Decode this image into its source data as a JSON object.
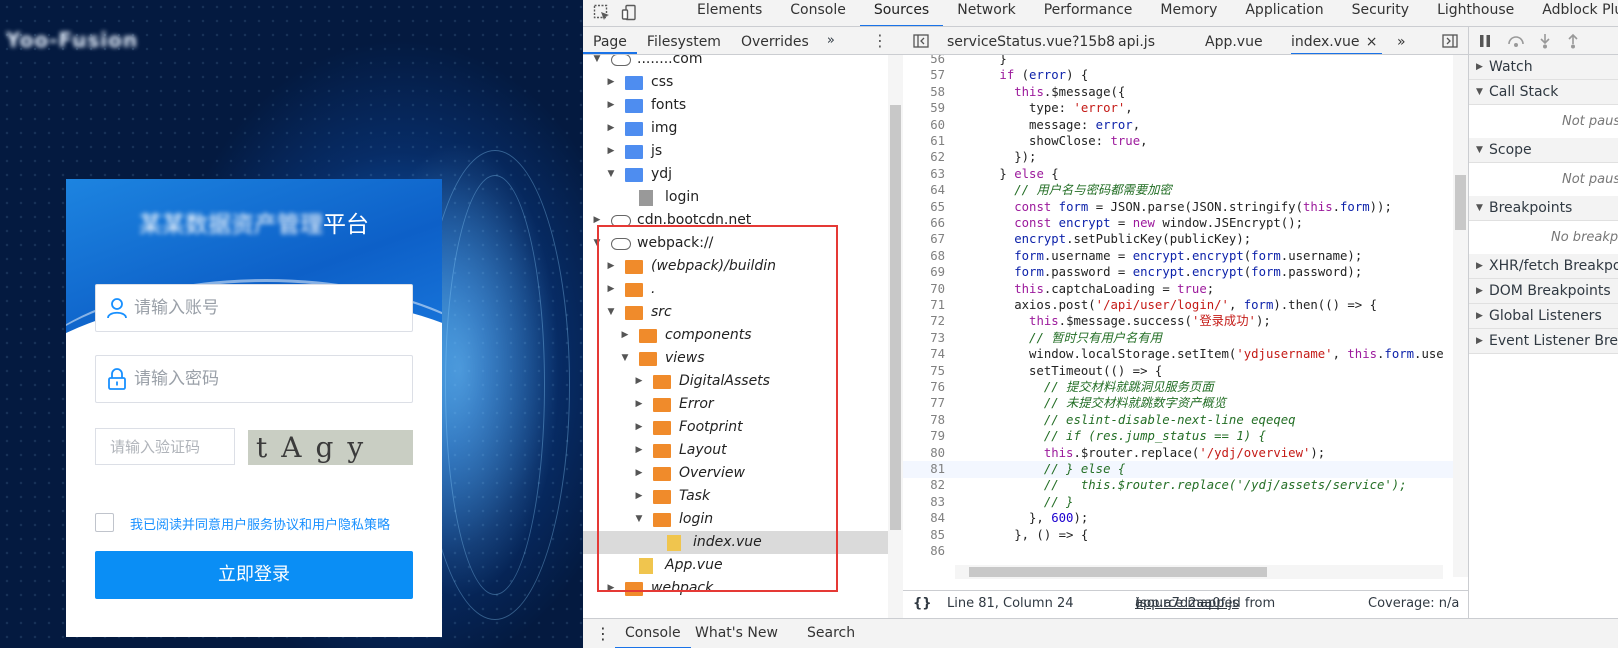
{
  "login": {
    "logo_text": "Yoo-Fusion",
    "title_blurred": "某某数据资产管理",
    "title_suffix": "平台",
    "username_placeholder": "请输入账号",
    "password_placeholder": "请输入密码",
    "captcha_placeholder": "请输入验证码",
    "captcha_text": "tAgy",
    "agreement": "我已阅读并同意用户服务协议和用户隐私策略",
    "submit_label": "立即登录"
  },
  "devtools": {
    "main_tabs": [
      "Elements",
      "Console",
      "Sources",
      "Network",
      "Performance",
      "Memory",
      "Application",
      "Security",
      "Lighthouse",
      "Adblock Plus"
    ],
    "main_more": "»",
    "nav_tabs": [
      "Page",
      "Filesystem",
      "Overrides"
    ],
    "nav_more": "»",
    "tree": [
      {
        "label": "........com",
        "type": "cloud",
        "depth": 0,
        "open": true
      },
      {
        "label": "css",
        "type": "folder-blue",
        "depth": 1
      },
      {
        "label": "fonts",
        "type": "folder-blue",
        "depth": 1
      },
      {
        "label": "img",
        "type": "folder-blue",
        "depth": 1
      },
      {
        "label": "js",
        "type": "folder-blue",
        "depth": 1
      },
      {
        "label": "ydj",
        "type": "folder-blue",
        "depth": 1,
        "open": true
      },
      {
        "label": "login",
        "type": "file-g",
        "depth": 2
      },
      {
        "label": "cdn.bootcdn.net",
        "type": "cloud",
        "depth": 0
      },
      {
        "label": "webpack://",
        "type": "cloud",
        "depth": 0,
        "open": true
      },
      {
        "label": "(webpack)/buildin",
        "type": "folder-orange",
        "depth": 1,
        "italic": true
      },
      {
        "label": ".",
        "type": "folder-orange",
        "depth": 1,
        "italic": true
      },
      {
        "label": "src",
        "type": "folder-orange",
        "depth": 1,
        "italic": true,
        "open": true
      },
      {
        "label": "components",
        "type": "folder-orange",
        "depth": 2,
        "italic": true
      },
      {
        "label": "views",
        "type": "folder-orange",
        "depth": 2,
        "italic": true,
        "open": true
      },
      {
        "label": "DigitalAssets",
        "type": "folder-orange",
        "depth": 3,
        "italic": true
      },
      {
        "label": "Error",
        "type": "folder-orange",
        "depth": 3,
        "italic": true
      },
      {
        "label": "Footprint",
        "type": "folder-orange",
        "depth": 3,
        "italic": true
      },
      {
        "label": "Layout",
        "type": "folder-orange",
        "depth": 3,
        "italic": true
      },
      {
        "label": "Overview",
        "type": "folder-orange",
        "depth": 3,
        "italic": true
      },
      {
        "label": "Task",
        "type": "folder-orange",
        "depth": 3,
        "italic": true
      },
      {
        "label": "login",
        "type": "folder-orange",
        "depth": 3,
        "italic": true,
        "open": true
      },
      {
        "label": "index.vue",
        "type": "file-y",
        "depth": 4,
        "italic": true,
        "selected": true
      },
      {
        "label": "App.vue",
        "type": "file-y",
        "depth": 2,
        "italic": true
      },
      {
        "label": "webpack",
        "type": "folder-orange",
        "depth": 1,
        "italic": true
      }
    ],
    "editor_tabs": [
      "serviceStatus.vue?15b8",
      "api.js",
      "App.vue",
      "index.vue"
    ],
    "editor_active": "index.vue",
    "editor_more": "»",
    "close_glyph": "×",
    "code_lines": [
      {
        "n": "56",
        "t": "      }"
      },
      {
        "n": "57",
        "t": "      if (error) {"
      },
      {
        "n": "58",
        "t": "        this.$message({"
      },
      {
        "n": "59",
        "t": "          type: 'error',"
      },
      {
        "n": "60",
        "t": "          message: error,"
      },
      {
        "n": "61",
        "t": "          showClose: true,"
      },
      {
        "n": "62",
        "t": "        });"
      },
      {
        "n": "63",
        "t": "      } else {"
      },
      {
        "n": "64",
        "t": "        // 用户名与密码都需要加密"
      },
      {
        "n": "65",
        "t": "        const form = JSON.parse(JSON.stringify(this.form));"
      },
      {
        "n": "66",
        "t": "        const encrypt = new window.JSEncrypt();"
      },
      {
        "n": "67",
        "t": "        encrypt.setPublicKey(publicKey);"
      },
      {
        "n": "68",
        "t": "        form.username = encrypt.encrypt(form.username);"
      },
      {
        "n": "69",
        "t": "        form.password = encrypt.encrypt(form.password);"
      },
      {
        "n": "70",
        "t": "        this.captchaLoading = true;"
      },
      {
        "n": "71",
        "t": "        axios.post('/api/user/login/', form).then(() => {"
      },
      {
        "n": "72",
        "t": "          this.$message.success('登录成功');"
      },
      {
        "n": "73",
        "t": "          // 暂时只有用户名有用"
      },
      {
        "n": "74",
        "t": "          window.localStorage.setItem('ydjusername', this.form.use"
      },
      {
        "n": "75",
        "t": "          setTimeout(() => {"
      },
      {
        "n": "76",
        "t": "            // 提交材料就跳洞见服务页面"
      },
      {
        "n": "77",
        "t": "            // 未提交材料就跳数字资产概览"
      },
      {
        "n": "78",
        "t": "            // eslint-disable-next-line eqeqeq"
      },
      {
        "n": "79",
        "t": "            // if (res.jump_status == 1) {"
      },
      {
        "n": "80",
        "t": "            this.$router.replace('/ydj/overview');"
      },
      {
        "n": "81",
        "t": "            // } else {"
      },
      {
        "n": "82",
        "t": "            //   this.$router.replace('/ydj/assets/service');"
      },
      {
        "n": "83",
        "t": "            // }"
      },
      {
        "n": "84",
        "t": "          }, 600);"
      },
      {
        "n": "85",
        "t": "        }, () => {"
      },
      {
        "n": "86",
        "t": ""
      }
    ],
    "status": {
      "braces": "{}",
      "position": "Line 81, Column 24",
      "mapped_prefix": "(source mapped from ",
      "mapped_file": "app.a7d2aa0f.js",
      "mapped_suffix": ")",
      "coverage": "Coverage: n/a"
    },
    "debugger_sections": [
      {
        "name": "Watch",
        "open": false
      },
      {
        "name": "Call Stack",
        "open": true,
        "empty": "Not paused"
      },
      {
        "name": "Scope",
        "open": true,
        "empty": "Not paused"
      },
      {
        "name": "Breakpoints",
        "open": true,
        "empty": "No breakpoints"
      },
      {
        "name": "XHR/fetch Breakpoints",
        "open": false
      },
      {
        "name": "DOM Breakpoints",
        "open": false
      },
      {
        "name": "Global Listeners",
        "open": false
      },
      {
        "name": "Event Listener Breakpoints",
        "open": false
      }
    ],
    "drawer_tabs": [
      "Console",
      "What's New",
      "Search"
    ],
    "drawer_kebab": "⋮"
  },
  "colors": {
    "accent": "#1a73e8",
    "login_button": "#0a8ef5",
    "highlight_box": "#e53935"
  }
}
